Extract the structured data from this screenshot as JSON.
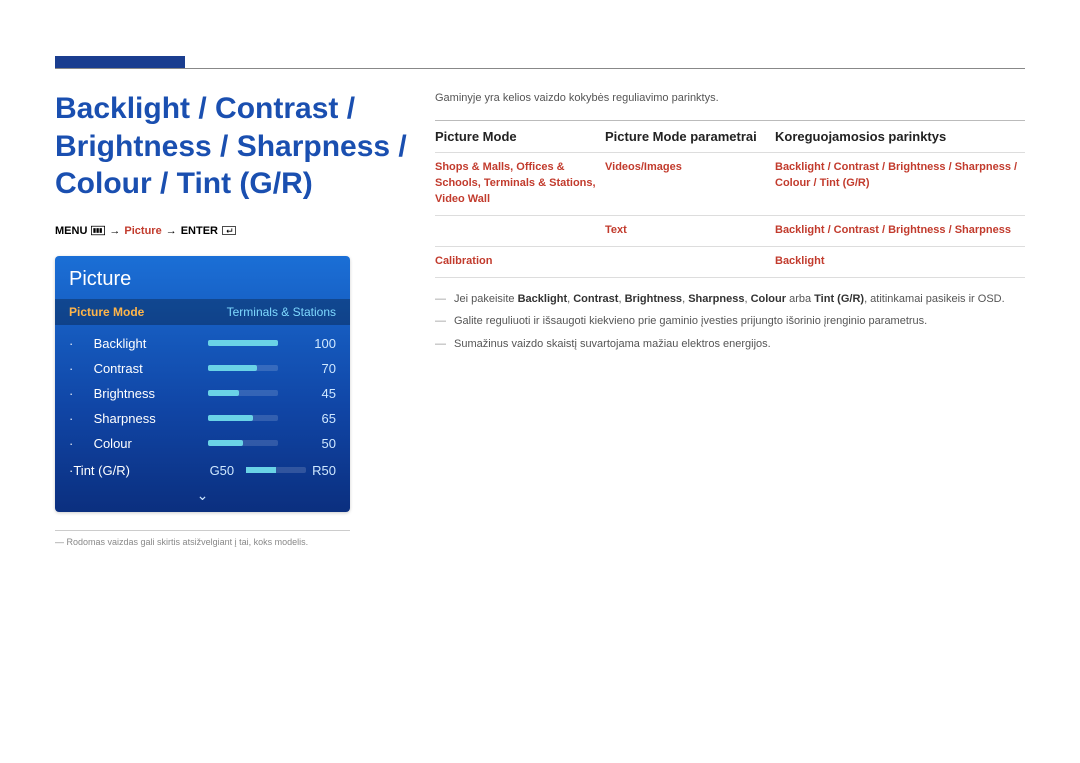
{
  "page_title": "Backlight / Contrast / Brightness / Sharpness / Colour / Tint (G/R)",
  "menu_path": {
    "prefix": "MENU",
    "step1": "Picture",
    "suffix": "ENTER",
    "arrow": "→"
  },
  "tv": {
    "title": "Picture",
    "header_label": "Picture Mode",
    "header_value": "Terminals & Stations",
    "items": [
      {
        "label": "Backlight",
        "value": "100",
        "pct": 100
      },
      {
        "label": "Contrast",
        "value": "70",
        "pct": 70
      },
      {
        "label": "Brightness",
        "value": "45",
        "pct": 45
      },
      {
        "label": "Sharpness",
        "value": "65",
        "pct": 65
      },
      {
        "label": "Colour",
        "value": "50",
        "pct": 50
      }
    ],
    "tint": {
      "label": "Tint (G/R)",
      "g": "G50",
      "r": "R50"
    },
    "chevron": "⌄"
  },
  "footnote": {
    "dash": "―",
    "text": "Rodomas vaizdas gali skirtis atsižvelgiant į tai, koks modelis."
  },
  "intro": "Gaminyje yra kelios vaizdo kokybės reguliavimo parinktys.",
  "table": {
    "headers": {
      "c1": "Picture Mode",
      "c2": "Picture Mode parametrai",
      "c3": "Koreguojamosios parinktys"
    },
    "rows": [
      {
        "c1": "Shops & Malls, Offices & Schools, Terminals & Stations, Video Wall",
        "c2": "Videos/Images",
        "c3": "Backlight / Contrast / Brightness / Sharpness / Colour / Tint (G/R)"
      },
      {
        "c1": "",
        "c2": "Text",
        "c3": "Backlight / Contrast / Brightness / Sharpness"
      },
      {
        "c1": "Calibration",
        "c2": "",
        "c3": "Backlight"
      }
    ]
  },
  "notes": {
    "n1_pre": "Jei pakeisite ",
    "n1_b1": "Backlight",
    "n1_s1": ", ",
    "n1_b2": "Contrast",
    "n1_s2": ", ",
    "n1_b3": "Brightness",
    "n1_s3": ", ",
    "n1_b4": "Sharpness",
    "n1_s4": ", ",
    "n1_b5": "Colour",
    "n1_s5": " arba ",
    "n1_b6": "Tint (G/R)",
    "n1_post": ", atitinkamai pasikeis ir OSD.",
    "n2": "Galite reguliuoti ir išsaugoti kiekvieno prie gaminio įvesties prijungto išorinio įrenginio parametrus.",
    "n3": "Sumažinus vaizdo skaistį suvartojama mažiau elektros energijos."
  }
}
